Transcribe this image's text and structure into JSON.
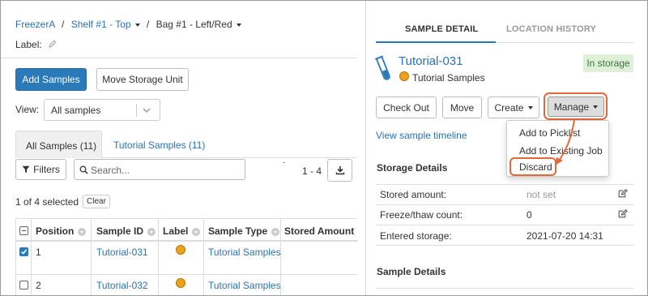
{
  "breadcrumb": {
    "freezer": "FreezerA",
    "sep1": "/",
    "shelf": "Shelf #1 - Top",
    "sep2": "/",
    "bag": "Bag #1 - Left/Red"
  },
  "label_field": {
    "label": "Label:"
  },
  "toolbar": {
    "add_samples": "Add Samples",
    "move_storage_unit": "Move Storage Unit"
  },
  "view": {
    "label": "View:",
    "selected": "All samples"
  },
  "tabs": [
    {
      "label": "All Samples (11)",
      "active": true
    },
    {
      "label": "Tutorial Samples (11)",
      "active": false
    }
  ],
  "grid_toolbar": {
    "filters": "Filters",
    "search_placeholder": "Search...",
    "paging": "1 - 4"
  },
  "selection": {
    "status": "1 of 4 selected",
    "clear": "Clear"
  },
  "table": {
    "columns": [
      "Position",
      "Sample ID",
      "Label",
      "Sample Type",
      "Stored Amount"
    ],
    "rows": [
      {
        "checked": true,
        "position": "1",
        "sample_id": "Tutorial-031",
        "label_color": "#f0a11b",
        "sample_type": "Tutorial Samples"
      },
      {
        "checked": false,
        "position": "2",
        "sample_id": "Tutorial-032",
        "label_color": "#f0a11b",
        "sample_type": "Tutorial Samples"
      }
    ]
  },
  "detail": {
    "tabs": [
      {
        "label": "SAMPLE DETAIL",
        "active": true
      },
      {
        "label": "LOCATION HISTORY",
        "active": false
      }
    ],
    "sample_name": "Tutorial-031",
    "sample_type": "Tutorial Samples",
    "status_badge": "In storage",
    "actions": {
      "check_out": "Check Out",
      "move": "Move",
      "create": "Create",
      "manage": "Manage"
    },
    "timeline_link": "View sample timeline",
    "manage_menu": [
      "Add to Picklist",
      "Add to Existing Job",
      "Discard"
    ],
    "storage_details": {
      "title": "Storage Details",
      "rows": [
        {
          "label": "Stored amount:",
          "value": "not set",
          "editable": true
        },
        {
          "label": "Freeze/thaw count:",
          "value": "0",
          "editable": true
        },
        {
          "label": "Entered storage:",
          "value": "2021-07-20 14:31",
          "editable": false
        }
      ]
    },
    "sample_details": {
      "title": "Sample Details"
    }
  },
  "colors": {
    "primary": "#2a7ab9",
    "link": "#2a72b5",
    "highlight": "#e2693a",
    "badge_bg": "#dff0d8",
    "badge_text": "#3c763d",
    "label_dot": "#f0a11b"
  },
  "icons": [
    "pencil-icon",
    "caret-down-icon",
    "filter-icon",
    "search-icon",
    "download-icon",
    "test-tube-icon",
    "edit-icon",
    "sort-icon",
    "checkbox-icon"
  ]
}
